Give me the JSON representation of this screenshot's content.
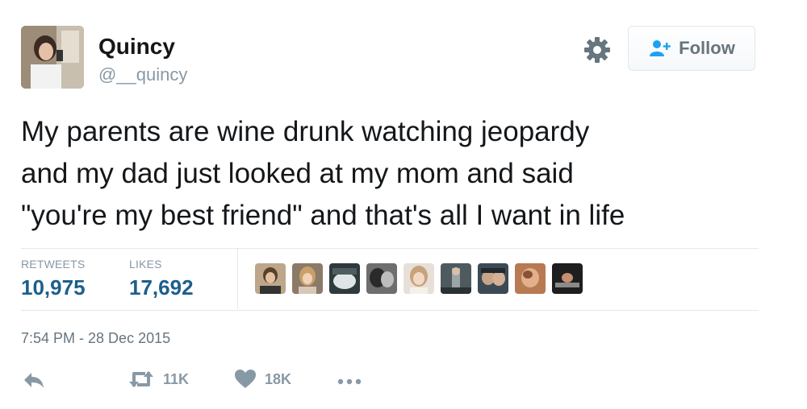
{
  "user": {
    "display_name": "Quincy",
    "handle": "@__quincy"
  },
  "header": {
    "follow_label": "Follow"
  },
  "tweet": {
    "text_lines": [
      "My parents are wine drunk watching jeopardy",
      "and my dad just looked at my mom and said",
      "\"you're my best friend\" and that's all I want in life"
    ],
    "timestamp": "7:54 PM - 28 Dec 2015"
  },
  "stats": {
    "retweets_label": "RETWEETS",
    "retweets_count": "10,975",
    "likes_label": "LIKES",
    "likes_count": "17,692"
  },
  "actions": {
    "retweet_count": "11K",
    "like_count": "18K"
  },
  "colors": {
    "count_blue": "#1b5f8c",
    "muted_gray": "#8899a6",
    "follow_icon_blue": "#1da1f2"
  }
}
